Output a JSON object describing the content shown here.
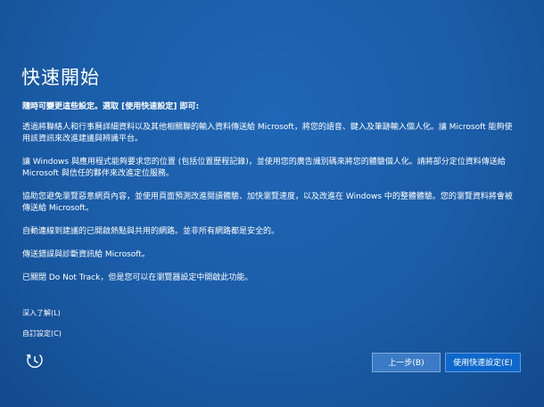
{
  "header": {
    "title": "快速開始"
  },
  "body": {
    "intro": "隨時可變更這些設定。選取 [使用快速設定] 即可:",
    "paragraphs": [
      "透過將聯絡人和行事曆詳細資料以及其他相關聯的輸入資料傳送給 Microsoft，將您的語音、鍵入及筆跡輸入個人化。讓 Microsoft 能夠使用該資訊來改進建議與辨識平台。",
      "讓 Windows 與應用程式能夠要求您的位置 (包括位置歷程記錄)，並使用您的廣告識別碼來將您的體驗個人化。請將部分定位資料傳送給 Microsoft 與信任的夥伴來改進定位服務。",
      "協助您避免瀏覽惡意網頁內容，並使用頁面預測改進閱讀體驗、加快瀏覽速度，以及改進在 Windows 中的整體體驗。您的瀏覽資料將會被傳送給 Microsoft。",
      "自動連線到建議的已開啟熱點與共用的網路。並非所有網路都是安全的。",
      "傳送錯誤與診斷資訊給 Microsoft。",
      "已關閉 Do Not Track，但是您可以在瀏覽器設定中開啟此功能。"
    ]
  },
  "links": {
    "learn_more": "深入了解(L)",
    "customize": "自訂設定(C)"
  },
  "icons": {
    "ease_of_access": "ease-of-access-icon"
  },
  "buttons": {
    "back": "上一步(B)",
    "express": "使用快速設定(E)"
  },
  "colors": {
    "background": "#1a5ca7",
    "express_button": "#0e68cc",
    "back_button": "#3b7bc6"
  }
}
